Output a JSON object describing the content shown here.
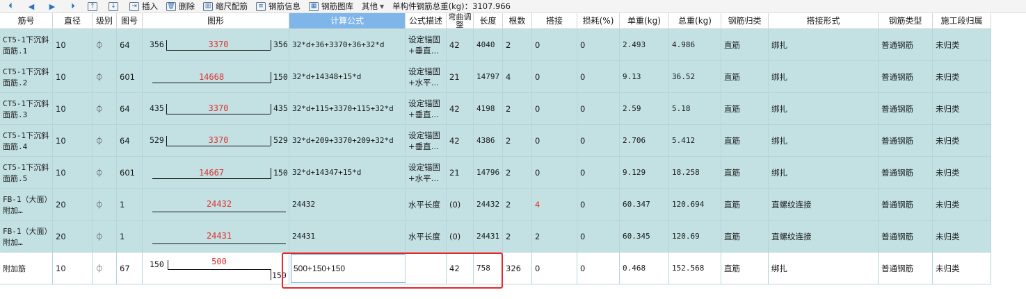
{
  "toolbar": {
    "nav": [
      "⏴",
      "◀",
      "▶",
      "⏵"
    ],
    "buttons": [
      {
        "name": "move-up-icon",
        "label": ""
      },
      {
        "name": "move-down-icon",
        "label": ""
      },
      {
        "name": "insert-button",
        "label": "插入"
      },
      {
        "name": "delete-button",
        "label": "删除"
      },
      {
        "name": "scale-rebar-button",
        "label": "缩尺配筋"
      },
      {
        "name": "rebar-info-button",
        "label": "钢筋信息"
      },
      {
        "name": "rebar-library-button",
        "label": "钢筋图库"
      },
      {
        "name": "other-button",
        "label": "其他"
      }
    ],
    "total_label": "单构件钢筋总重(kg)：3107.966"
  },
  "columns": [
    "筋号",
    "直径(mm)",
    "级别",
    "图号",
    "图形",
    "计算公式",
    "公式描述",
    "弯曲调整",
    "长度",
    "根数",
    "搭接",
    "损耗(%)",
    "单重(kg)",
    "总重(kg)",
    "钢筋归类",
    "搭接形式",
    "钢筋类型",
    "施工段归属"
  ],
  "grade_symbol": "⏀",
  "rows": [
    {
      "name": "CT5-1下沉斜面筋.1",
      "dia": "10",
      "grade": "⏀",
      "fig": "64",
      "shape": {
        "type": "u",
        "left": "356",
        "mid": "3370",
        "right": "356"
      },
      "formula": "32*d+36+3370+36+32*d",
      "desc": "设定锚固+垂直…",
      "bend": "42",
      "len": "4040",
      "count": "2",
      "lap": "0",
      "loss": "0",
      "unit": "2.493",
      "total": "4.986",
      "cls": "直筋",
      "lapform": "绑扎",
      "type": "普通钢筋",
      "seg": "未归类"
    },
    {
      "name": "CT5-1下沉斜面筋.2",
      "dia": "10",
      "grade": "⏀",
      "fig": "601",
      "shape": {
        "type": "l",
        "mid": "14668",
        "right": "150"
      },
      "formula": "32*d+14348+15*d",
      "desc": "设定锚固+水平…",
      "bend": "21",
      "len": "14797",
      "count": "4",
      "lap": "0",
      "loss": "0",
      "unit": "9.13",
      "total": "36.52",
      "cls": "直筋",
      "lapform": "绑扎",
      "type": "普通钢筋",
      "seg": "未归类"
    },
    {
      "name": "CT5-1下沉斜面筋.3",
      "dia": "10",
      "grade": "⏀",
      "fig": "64",
      "shape": {
        "type": "u",
        "left": "435",
        "mid": "3370",
        "right": "435"
      },
      "formula": "32*d+115+3370+115+32*d",
      "desc": "设定锚固+垂直…",
      "bend": "42",
      "len": "4198",
      "count": "2",
      "lap": "0",
      "loss": "0",
      "unit": "2.59",
      "total": "5.18",
      "cls": "直筋",
      "lapform": "绑扎",
      "type": "普通钢筋",
      "seg": "未归类"
    },
    {
      "name": "CT5-1下沉斜面筋.4",
      "dia": "10",
      "grade": "⏀",
      "fig": "64",
      "shape": {
        "type": "u",
        "left": "529",
        "mid": "3370",
        "right": "529"
      },
      "formula": "32*d+209+3370+209+32*d",
      "desc": "设定锚固+垂直…",
      "bend": "42",
      "len": "4386",
      "count": "2",
      "lap": "0",
      "loss": "0",
      "unit": "2.706",
      "total": "5.412",
      "cls": "直筋",
      "lapform": "绑扎",
      "type": "普通钢筋",
      "seg": "未归类"
    },
    {
      "name": "CT5-1下沉斜面筋.5",
      "dia": "10",
      "grade": "⏀",
      "fig": "601",
      "shape": {
        "type": "l",
        "mid": "14667",
        "right": "150"
      },
      "formula": "32*d+14347+15*d",
      "desc": "设定锚固+水平…",
      "bend": "21",
      "len": "14796",
      "count": "2",
      "lap": "0",
      "loss": "0",
      "unit": "9.129",
      "total": "18.258",
      "cls": "直筋",
      "lapform": "绑扎",
      "type": "普通钢筋",
      "seg": "未归类"
    },
    {
      "name": "FB-1（大面）附加…",
      "dia": "20",
      "grade": "⏀",
      "fig": "1",
      "shape": {
        "type": "s",
        "mid": "24432"
      },
      "formula": "24432",
      "desc": "水平长度",
      "bend": "(0)",
      "len": "24432",
      "count": "2",
      "lap": "4",
      "lapRed": true,
      "loss": "0",
      "unit": "60.347",
      "total": "120.694",
      "cls": "直筋",
      "lapform": "直螺纹连接",
      "type": "普通钢筋",
      "seg": "未归类"
    },
    {
      "name": "FB-1（大面）附加…",
      "dia": "20",
      "grade": "⏀",
      "fig": "1",
      "shape": {
        "type": "s",
        "mid": "24431"
      },
      "formula": "24431",
      "desc": "水平长度",
      "bend": "(0)",
      "len": "24431",
      "count": "2",
      "lap": "2",
      "loss": "0",
      "unit": "60.345",
      "total": "120.69",
      "cls": "直筋",
      "lapform": "直螺纹连接",
      "type": "普通钢筋",
      "seg": "未归类"
    },
    {
      "name": "附加筋",
      "dia": "10",
      "grade": "⏀",
      "fig": "67",
      "shape": {
        "type": "z",
        "left": "150",
        "mid": "500",
        "right": "150"
      },
      "formula": "500+150+150",
      "desc": "",
      "bend": "42",
      "len": "758",
      "count": "326",
      "lap": "0",
      "loss": "0",
      "unit": "0.468",
      "total": "152.568",
      "cls": "直筋",
      "lapform": "绑扎",
      "type": "普通钢筋",
      "seg": "未归类"
    }
  ],
  "colors": {
    "row_bg": "#c3e0e3",
    "header_selected": "#7fb6ea",
    "highlight": "#e8262a",
    "red_text": "#e0312e"
  }
}
